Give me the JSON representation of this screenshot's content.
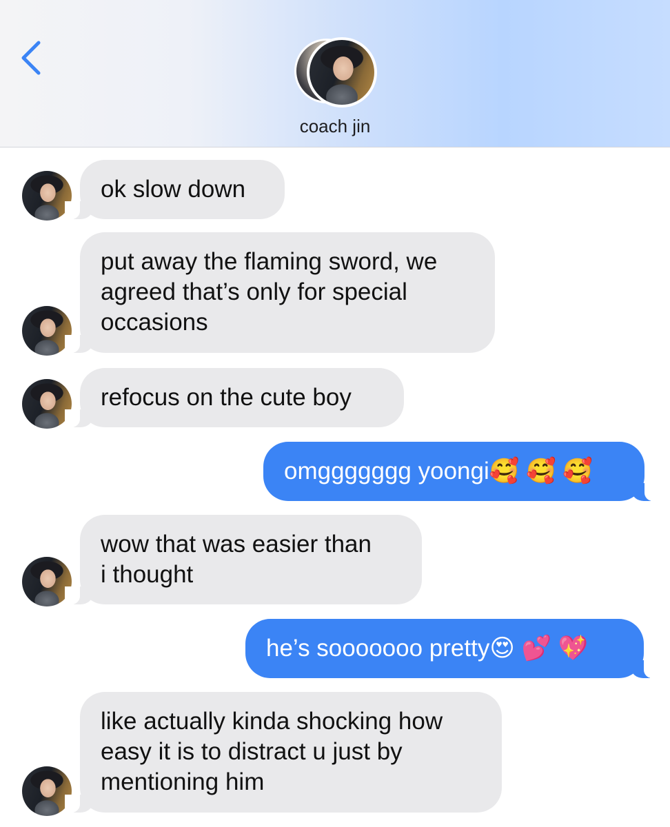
{
  "header": {
    "back_icon": "chevron-left-icon",
    "contact_name": "coach jin",
    "accent_color": "#3b84f5"
  },
  "messages": [
    {
      "sender": "contact",
      "text": "ok slow down"
    },
    {
      "sender": "contact",
      "text": "put away the flaming sword, we\nagreed that’s only for special\noccasions"
    },
    {
      "sender": "contact",
      "text": "refocus on the cute boy"
    },
    {
      "sender": "me",
      "text": "omggggggg yoongi🥰 🥰 🥰"
    },
    {
      "sender": "contact",
      "text": "wow that was easier than\ni thought"
    },
    {
      "sender": "me",
      "text": "he’s sooooooo pretty😍 💕 💖"
    },
    {
      "sender": "contact",
      "text": "like actually kinda shocking how\neasy it is to distract u just by\nmentioning him"
    }
  ]
}
